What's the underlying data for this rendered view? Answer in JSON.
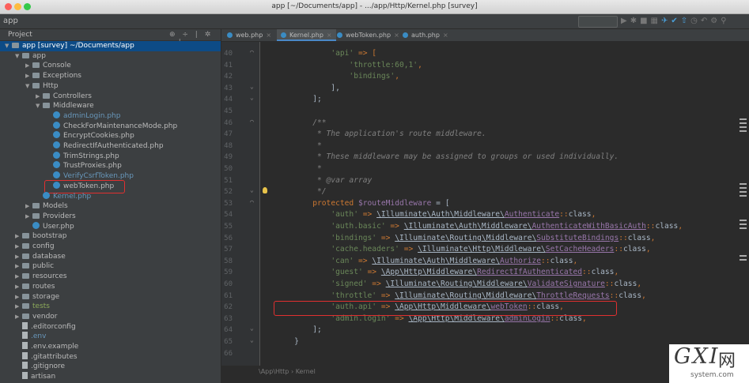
{
  "window": {
    "title": "app [~/Documents/app] - .../app/Http/Kernel.php [survey]"
  },
  "project_bar": {
    "name": "app"
  },
  "sidebar": {
    "header": "Project",
    "tree": [
      {
        "label": "app [survey] ~/Documents/app",
        "kind": "folder",
        "depth": 0,
        "arrow": "▼",
        "selected": true
      },
      {
        "label": "app",
        "kind": "folder",
        "depth": 1,
        "arrow": "▼"
      },
      {
        "label": "Console",
        "kind": "folder",
        "depth": 2,
        "arrow": "▶"
      },
      {
        "label": "Exceptions",
        "kind": "folder",
        "depth": 2,
        "arrow": "▶"
      },
      {
        "label": "Http",
        "kind": "folder",
        "depth": 2,
        "arrow": "▼"
      },
      {
        "label": "Controllers",
        "kind": "folder",
        "depth": 3,
        "arrow": "▶"
      },
      {
        "label": "Middleware",
        "kind": "folder",
        "depth": 3,
        "arrow": "▼"
      },
      {
        "label": "adminLogin.php",
        "kind": "php",
        "depth": 4,
        "color": "blue"
      },
      {
        "label": "CheckForMaintenanceMode.php",
        "kind": "php",
        "depth": 4
      },
      {
        "label": "EncryptCookies.php",
        "kind": "php",
        "depth": 4
      },
      {
        "label": "RedirectIfAuthenticated.php",
        "kind": "php",
        "depth": 4
      },
      {
        "label": "TrimStrings.php",
        "kind": "php",
        "depth": 4
      },
      {
        "label": "TrustProxies.php",
        "kind": "php",
        "depth": 4
      },
      {
        "label": "VerifyCsrfToken.php",
        "kind": "php",
        "depth": 4,
        "color": "blue"
      },
      {
        "label": "webToken.php",
        "kind": "php",
        "depth": 4,
        "boxed": true
      },
      {
        "label": "Kernel.php",
        "kind": "php",
        "depth": 3,
        "color": "blue"
      },
      {
        "label": "Models",
        "kind": "folder",
        "depth": 2,
        "arrow": "▶"
      },
      {
        "label": "Providers",
        "kind": "folder",
        "depth": 2,
        "arrow": "▶"
      },
      {
        "label": "User.php",
        "kind": "php",
        "depth": 2
      },
      {
        "label": "bootstrap",
        "kind": "folder",
        "depth": 1,
        "arrow": "▶"
      },
      {
        "label": "config",
        "kind": "folder",
        "depth": 1,
        "arrow": "▶"
      },
      {
        "label": "database",
        "kind": "folder",
        "depth": 1,
        "arrow": "▶"
      },
      {
        "label": "public",
        "kind": "folder",
        "depth": 1,
        "arrow": "▶"
      },
      {
        "label": "resources",
        "kind": "folder",
        "depth": 1,
        "arrow": "▶"
      },
      {
        "label": "routes",
        "kind": "folder",
        "depth": 1,
        "arrow": "▶"
      },
      {
        "label": "storage",
        "kind": "folder",
        "depth": 1,
        "arrow": "▶"
      },
      {
        "label": "tests",
        "kind": "folder",
        "depth": 1,
        "arrow": "▶",
        "color": "green"
      },
      {
        "label": "vendor",
        "kind": "folder",
        "depth": 1,
        "arrow": "▶"
      },
      {
        "label": ".editorconfig",
        "kind": "file",
        "depth": 1
      },
      {
        "label": ".env",
        "kind": "file",
        "depth": 1,
        "color": "blue"
      },
      {
        "label": ".env.example",
        "kind": "file",
        "depth": 1
      },
      {
        "label": ".gitattributes",
        "kind": "file",
        "depth": 1
      },
      {
        "label": ".gitignore",
        "kind": "file",
        "depth": 1
      },
      {
        "label": "artisan",
        "kind": "file",
        "depth": 1
      }
    ]
  },
  "tabs": [
    {
      "label": "web.php",
      "active": false
    },
    {
      "label": "Kernel.php",
      "active": true
    },
    {
      "label": "webToken.php",
      "active": false
    },
    {
      "label": "auth.php",
      "active": false
    }
  ],
  "editor": {
    "line_numbers": [
      "40",
      "41",
      "42",
      "43",
      "44",
      "45",
      "46",
      "47",
      "48",
      "49",
      "50",
      "51",
      "52",
      "53",
      "54",
      "55",
      "56",
      "57",
      "58",
      "59",
      "60",
      "61",
      "62",
      "63",
      "64",
      "65",
      "66"
    ],
    "lines": [
      [
        [
          "            ",
          ""
        ],
        [
          "'api'",
          "str"
        ],
        [
          " => [",
          "kw"
        ]
      ],
      [
        [
          "                ",
          ""
        ],
        [
          "'throttle:60,1'",
          "str"
        ],
        [
          ",",
          "kw"
        ]
      ],
      [
        [
          "                ",
          ""
        ],
        [
          "'bindings'",
          "str"
        ],
        [
          ",",
          "kw"
        ]
      ],
      [
        [
          "            ],",
          ""
        ]
      ],
      [
        [
          "        ];",
          ""
        ]
      ],
      [
        [
          "",
          ""
        ]
      ],
      [
        [
          "        /**",
          "cm"
        ]
      ],
      [
        [
          "         * The application's route middleware.",
          "cm"
        ]
      ],
      [
        [
          "         *",
          "cm"
        ]
      ],
      [
        [
          "         * These middleware may be assigned to groups or used individually.",
          "cm"
        ]
      ],
      [
        [
          "         *",
          "cm"
        ]
      ],
      [
        [
          "         * @var array",
          "cm"
        ]
      ],
      [
        [
          "         */",
          "cm"
        ]
      ],
      [
        [
          "        ",
          ""
        ],
        [
          "protected",
          "kw"
        ],
        [
          " ",
          ""
        ],
        [
          "$routeMiddleware",
          "var"
        ],
        [
          " = [",
          ""
        ]
      ],
      [
        [
          "            ",
          ""
        ],
        [
          "'auth'",
          "str"
        ],
        [
          " => ",
          "kw"
        ],
        [
          "\\Illuminate\\Auth\\Middleware\\",
          "ref"
        ],
        [
          "Authenticate",
          "ref2"
        ],
        [
          "::",
          "kw"
        ],
        [
          "class",
          ""
        ],
        [
          ",",
          "kw"
        ]
      ],
      [
        [
          "            ",
          ""
        ],
        [
          "'auth.basic'",
          "str"
        ],
        [
          " => ",
          "kw"
        ],
        [
          "\\Illuminate\\Auth\\Middleware\\",
          "ref"
        ],
        [
          "AuthenticateWithBasicAuth",
          "ref2"
        ],
        [
          "::",
          "kw"
        ],
        [
          "class",
          ""
        ],
        [
          ",",
          "kw"
        ]
      ],
      [
        [
          "            ",
          ""
        ],
        [
          "'bindings'",
          "str"
        ],
        [
          " => ",
          "kw"
        ],
        [
          "\\Illuminate\\Routing\\Middleware\\",
          "ref"
        ],
        [
          "SubstituteBindings",
          "ref2"
        ],
        [
          "::",
          "kw"
        ],
        [
          "class",
          ""
        ],
        [
          ",",
          "kw"
        ]
      ],
      [
        [
          "            ",
          ""
        ],
        [
          "'cache.headers'",
          "str"
        ],
        [
          " => ",
          "kw"
        ],
        [
          "\\Illuminate\\Http\\Middleware\\",
          "ref"
        ],
        [
          "SetCacheHeaders",
          "ref2"
        ],
        [
          "::",
          "kw"
        ],
        [
          "class",
          ""
        ],
        [
          ",",
          "kw"
        ]
      ],
      [
        [
          "            ",
          ""
        ],
        [
          "'can'",
          "str"
        ],
        [
          " => ",
          "kw"
        ],
        [
          "\\Illuminate\\Auth\\Middleware\\",
          "ref"
        ],
        [
          "Authorize",
          "ref2"
        ],
        [
          "::",
          "kw"
        ],
        [
          "class",
          ""
        ],
        [
          ",",
          "kw"
        ]
      ],
      [
        [
          "            ",
          ""
        ],
        [
          "'guest'",
          "str"
        ],
        [
          " => ",
          "kw"
        ],
        [
          "\\App\\Http\\Middleware\\",
          "ref"
        ],
        [
          "RedirectIfAuthenticated",
          "ref2"
        ],
        [
          "::",
          "kw"
        ],
        [
          "class",
          ""
        ],
        [
          ",",
          "kw"
        ]
      ],
      [
        [
          "            ",
          ""
        ],
        [
          "'signed'",
          "str"
        ],
        [
          " => ",
          "kw"
        ],
        [
          "\\Illuminate\\Routing\\Middleware\\",
          "ref"
        ],
        [
          "ValidateSignature",
          "ref2"
        ],
        [
          "::",
          "kw"
        ],
        [
          "class",
          ""
        ],
        [
          ",",
          "kw"
        ]
      ],
      [
        [
          "            ",
          ""
        ],
        [
          "'throttle'",
          "str"
        ],
        [
          " => ",
          "kw"
        ],
        [
          "\\Illuminate\\Routing\\Middleware\\",
          "ref"
        ],
        [
          "ThrottleRequests",
          "ref2"
        ],
        [
          "::",
          "kw"
        ],
        [
          "class",
          ""
        ],
        [
          ",",
          "kw"
        ]
      ],
      [
        [
          "            ",
          ""
        ],
        [
          "'auth.api'",
          "str"
        ],
        [
          " => ",
          "kw"
        ],
        [
          "\\App\\Http\\Middleware\\",
          "ref"
        ],
        [
          "webToken",
          "ref2"
        ],
        [
          "::",
          "kw"
        ],
        [
          "class",
          ""
        ],
        [
          ",",
          "kw"
        ]
      ],
      [
        [
          "            ",
          ""
        ],
        [
          "'admin.login'",
          "str"
        ],
        [
          " => ",
          "kw"
        ],
        [
          "\\App\\Http\\Middleware\\",
          "ref"
        ],
        [
          "adminLogin",
          "ref2"
        ],
        [
          "::",
          "kw"
        ],
        [
          "class",
          ""
        ],
        [
          ",",
          "kw"
        ]
      ],
      [
        [
          "        ];",
          ""
        ]
      ],
      [
        [
          "    }",
          ""
        ]
      ],
      [
        [
          "",
          ""
        ]
      ]
    ]
  },
  "statusbar": {
    "path": "\\App\\Http",
    "sep": "›",
    "cls": "Kernel"
  },
  "watermark": {
    "brand": "GXI",
    "cn": "网",
    "domain": "system.com"
  },
  "colors": {
    "selection": "#0d4b86",
    "highlight_box": "#e03030",
    "tab_underline": "#4a88c7"
  }
}
